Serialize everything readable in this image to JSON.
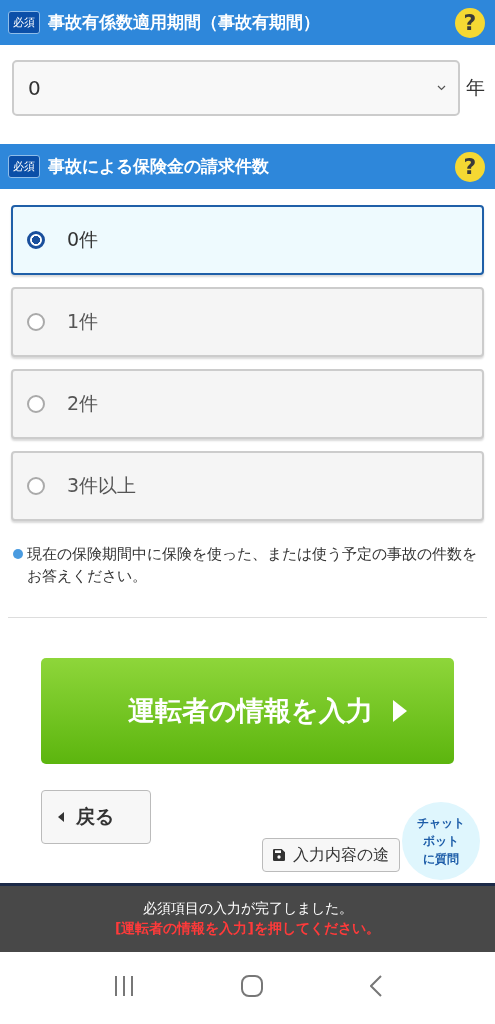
{
  "sections": [
    {
      "badge": "必須",
      "title": "事故有係数適用期間（事故有期間）",
      "help": "?",
      "kind": "select",
      "select": {
        "value": "0",
        "unit": "年"
      }
    },
    {
      "badge": "必須",
      "title": "事故による保険金の請求件数",
      "help": "?",
      "kind": "radio",
      "options": [
        {
          "label": "0件",
          "selected": true
        },
        {
          "label": "1件",
          "selected": false
        },
        {
          "label": "2件",
          "selected": false
        },
        {
          "label": "3件以上",
          "selected": false
        }
      ],
      "note": "現在の保険期間中に保険を使った、または使う予定の事故の件数をお答えください。"
    }
  ],
  "next_button": "運転者の情報を入力",
  "back_button": "戻る",
  "save_button": "入力内容の途",
  "chat_bubble": [
    "チャット",
    "ボット",
    "に質問"
  ],
  "status": {
    "message": "必須項目の入力が完了しました。",
    "instruction": "[運転者の情報を入力]を押してください。"
  }
}
